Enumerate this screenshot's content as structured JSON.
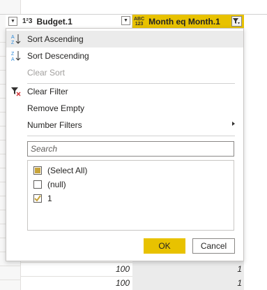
{
  "header": {
    "budget_type": "1²3",
    "budget_label": "Budget.1",
    "month_type_top": "ABC",
    "month_type_bottom": "123",
    "month_label": "Month eq Month.1"
  },
  "menu": {
    "sort_ascending": "Sort Ascending",
    "sort_descending": "Sort Descending",
    "clear_sort": "Clear Sort",
    "clear_filter": "Clear Filter",
    "remove_empty": "Remove Empty",
    "number_filters": "Number Filters"
  },
  "search": {
    "placeholder": "Search"
  },
  "filter_list": [
    {
      "label": "(Select All)",
      "state": "partial"
    },
    {
      "label": "(null)",
      "state": "unchecked"
    },
    {
      "label": "1",
      "state": "checked"
    }
  ],
  "buttons": {
    "ok": "OK",
    "cancel": "Cancel"
  },
  "rows": [
    {
      "budget": "100",
      "month": "1"
    },
    {
      "budget": "100",
      "month": "1"
    },
    {
      "budget": "100",
      "month": "1"
    }
  ],
  "colors": {
    "accent": "#e8c200",
    "selected_bg": "#ebebeb"
  }
}
